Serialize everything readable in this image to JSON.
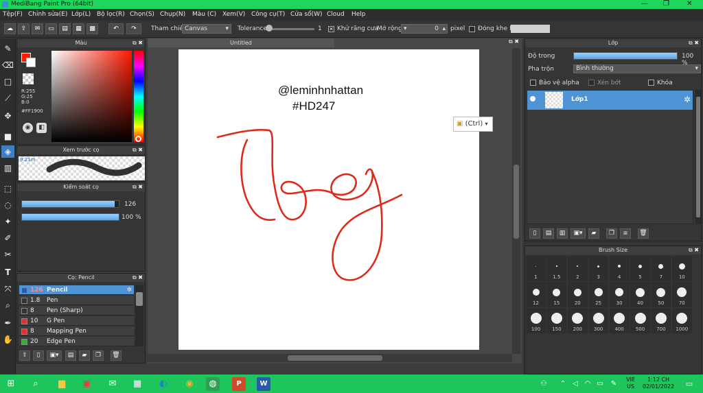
{
  "window": {
    "title": "MediBang Paint Pro (64bit)"
  },
  "menu": [
    "Tệp(F)",
    "Chỉnh sửa(E)",
    "Lớp(L)",
    "Bộ lọc(R)",
    "Chọn(S)",
    "Chụp(N)",
    "Màu (C)",
    "Xem(V)",
    "Công cụ(T)",
    "Cửa sổ(W)",
    "Cloud",
    "Help"
  ],
  "toolbar": {
    "reference_label": "Tham chiếu",
    "reference_value": "Canvas",
    "tolerance_label": "Tolerance",
    "tolerance_value": "1",
    "antialias_label": "Khử răng cưa",
    "expand_label": "Mở rộng",
    "expand_value": "0",
    "expand_unit": "pixel",
    "close_gap_label": "Đóng khe hở"
  },
  "color_panel": {
    "title": "Màu",
    "r": "R:255",
    "g": "G:25",
    "b": "B:0",
    "hex": "#FF1900",
    "primary_color": "#ff1900"
  },
  "brush_preview": {
    "title": "Xem trước cọ",
    "size": "9.21m"
  },
  "brush_control": {
    "title": "Kiểm soát cọ",
    "size_value": "126",
    "opacity_value": "100 %",
    "size_fraction": 0.96,
    "opacity_fraction": 1.0
  },
  "brush_list": {
    "title": "Cọ: Pencil",
    "items": [
      {
        "size": "126",
        "name": "Pencil",
        "color": "#2a5fa8",
        "selected": true
      },
      {
        "size": "1.8",
        "name": "Pen",
        "color": "#333333",
        "selected": false
      },
      {
        "size": "8",
        "name": "Pen (Sharp)",
        "color": "#333333",
        "selected": false
      },
      {
        "size": "10",
        "name": "G Pen",
        "color": "#e03030",
        "selected": false
      },
      {
        "size": "8",
        "name": "Mapping Pen",
        "color": "#e03030",
        "selected": false
      },
      {
        "size": "20",
        "name": "Edge Pen",
        "color": "#30b030",
        "selected": false
      }
    ]
  },
  "canvas": {
    "tab_title": "Untitled",
    "text_line1": "@leminhnhattan",
    "text_line2": "#HD247",
    "paste_badge": "(Ctrl)",
    "stroke_color": "#dd2a1a"
  },
  "layer_panel": {
    "title": "Lớp",
    "opacity_label": "Độ trong",
    "opacity_value": "100 %",
    "opacity_fraction": 1.0,
    "blend_label": "Pha trộn",
    "blend_value": "Bình thường",
    "protect_alpha": "Bảo vệ alpha",
    "clipping": "Xén bớt",
    "lock": "Khóa",
    "layers": [
      {
        "name": "Lớp1",
        "selected": true
      }
    ]
  },
  "brush_size_panel": {
    "title": "Brush Size",
    "sizes": [
      "1",
      "1.5",
      "2",
      "3",
      "4",
      "5",
      "7",
      "10",
      "12",
      "15",
      "20",
      "25",
      "30",
      "40",
      "50",
      "70",
      "100",
      "150",
      "200",
      "300",
      "400",
      "500",
      "700",
      "1000"
    ]
  },
  "taskbar": {
    "lang_top": "VIE",
    "lang_bottom": "US",
    "time": "1:12 CH",
    "date": "02/01/2022"
  }
}
